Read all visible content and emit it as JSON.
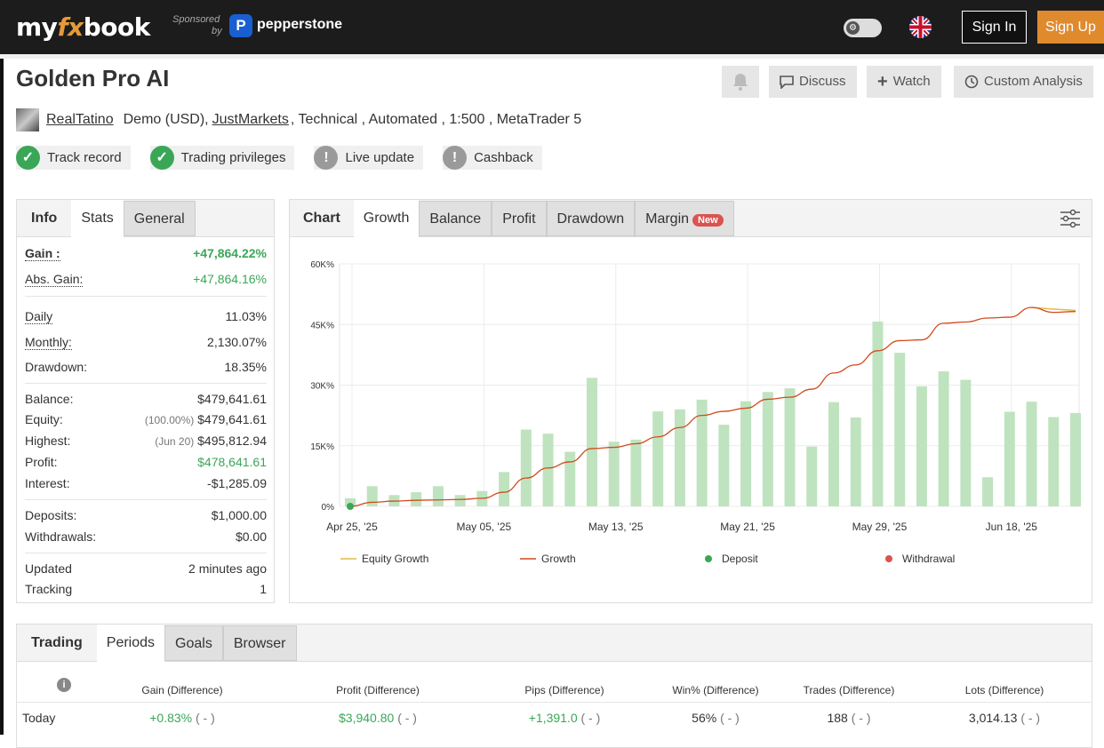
{
  "header": {
    "logo_pre": "my",
    "logo_fx": "fx",
    "logo_post": "book",
    "sponsored_line1": "Sponsored",
    "sponsored_line2": "by",
    "sponsor_icon": "P",
    "sponsor_name": "pepperstone",
    "signin_label": "Sign In",
    "signup_label": "Sign Up"
  },
  "page": {
    "title": "Golden Pro AI",
    "actions": {
      "discuss": "Discuss",
      "watch": "Watch",
      "custom_analysis": "Custom Analysis"
    },
    "meta": {
      "user": "RealTatino",
      "account_type": "Demo (USD),",
      "broker": "JustMarkets",
      "details": ", Technical , Automated , 1:500 , MetaTrader 5"
    },
    "badges": [
      {
        "label": "Track record",
        "icon": "check-icon"
      },
      {
        "label": "Trading privileges",
        "icon": "check-icon"
      },
      {
        "label": "Live update",
        "icon": "exclamation-icon"
      },
      {
        "label": "Cashback",
        "icon": "exclamation-icon"
      }
    ]
  },
  "info": {
    "tabs": [
      "Info",
      "Stats",
      "General"
    ],
    "gain_label": "Gain :",
    "gain_value": "+47,864.22%",
    "abs_gain_label": "Abs. Gain:",
    "abs_gain_value": "+47,864.16%",
    "daily_label": "Daily",
    "daily_value": "11.03%",
    "monthly_label": "Monthly:",
    "monthly_value": "2,130.07%",
    "drawdown_label": "Drawdown:",
    "drawdown_value": "18.35%",
    "balance_label": "Balance:",
    "balance_value": "$479,641.61",
    "equity_label": "Equity:",
    "equity_pct": "(100.00%)",
    "equity_value": "$479,641.61",
    "highest_label": "Highest:",
    "highest_date": "(Jun 20)",
    "highest_value": "$495,812.94",
    "profit_label": "Profit:",
    "profit_value": "$478,641.61",
    "interest_label": "Interest:",
    "interest_value": "-$1,285.09",
    "deposits_label": "Deposits:",
    "deposits_value": "$1,000.00",
    "withdrawals_label": "Withdrawals:",
    "withdrawals_value": "$0.00",
    "updated_label": "Updated",
    "updated_value": "2 minutes ago",
    "tracking_label": "Tracking",
    "tracking_value": "1"
  },
  "chart_tabs": {
    "label": "Chart",
    "items": [
      "Growth",
      "Balance",
      "Profit",
      "Drawdown",
      "Margin"
    ],
    "new_badge": "New"
  },
  "chart_data": {
    "type": "bar",
    "ylim": [
      0,
      60000
    ],
    "yticks": [
      "0%",
      "15K%",
      "30K%",
      "45K%",
      "60K%"
    ],
    "xticks": [
      "Apr 25, '25",
      "May 05, '25",
      "May 13, '25",
      "May 21, '25",
      "May 29, '25",
      "Jun 18, '25"
    ],
    "bars": [
      2000,
      5000,
      2800,
      3500,
      5000,
      2800,
      3800,
      8500,
      19000,
      18000,
      13500,
      31800,
      16000,
      16500,
      23500,
      24000,
      26400,
      20200,
      26000,
      28300,
      29200,
      14800,
      25800,
      22000,
      45700,
      38000,
      29700,
      33400,
      31300,
      7200,
      23400,
      25900,
      22100,
      23100
    ],
    "growth": [
      0,
      1000,
      1300,
      1500,
      1600,
      1700,
      2000,
      3500,
      7000,
      9500,
      11000,
      14300,
      14600,
      15500,
      17200,
      19500,
      22500,
      23500,
      24300,
      26500,
      27000,
      29000,
      33000,
      35000,
      38500,
      41000,
      41200,
      45300,
      45600,
      46600,
      46800,
      49200,
      48000,
      48200
    ],
    "equity_growth_end": [
      49200,
      48800,
      48500
    ],
    "legend": [
      "Equity Growth",
      "Growth",
      "Deposit",
      "Withdrawal"
    ]
  },
  "trading": {
    "tabs": [
      "Trading",
      "Periods",
      "Goals",
      "Browser"
    ],
    "columns": [
      "Gain (Difference)",
      "Profit (Difference)",
      "Pips (Difference)",
      "Win% (Difference)",
      "Trades (Difference)",
      "Lots (Difference)"
    ],
    "rows": [
      {
        "period": "Today",
        "gain": "+0.83%",
        "profit": "$3,940.80",
        "pips": "+1,391.0",
        "win": "56%",
        "trades": "188",
        "lots": "3,014.13",
        "diff": "( - )"
      }
    ]
  }
}
